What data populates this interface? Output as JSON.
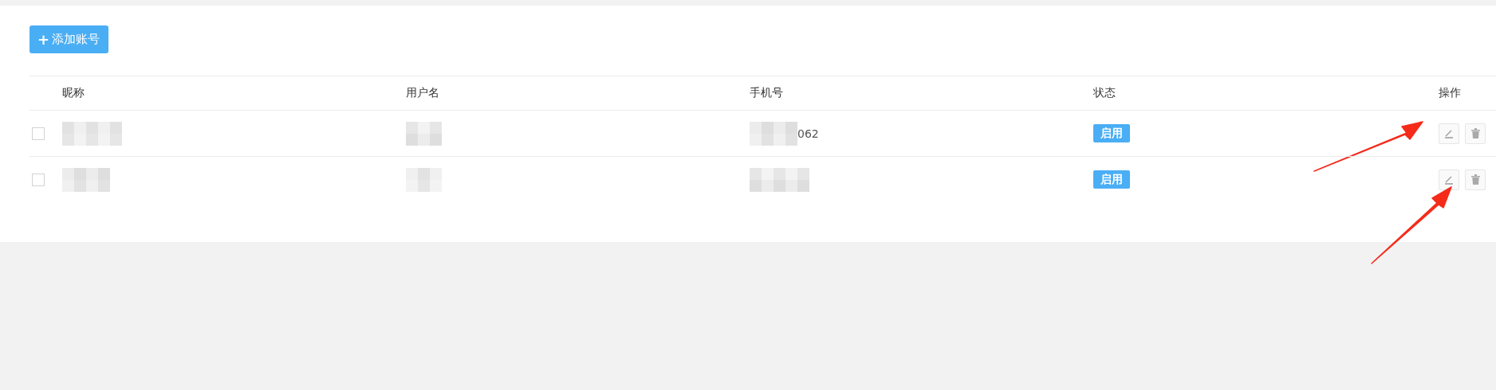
{
  "toolbar": {
    "add_button": {
      "icon": "+",
      "label": "添加账号"
    }
  },
  "table": {
    "columns": [
      "昵称",
      "用户名",
      "手机号",
      "状态",
      "操作"
    ],
    "rows": [
      {
        "checked": false,
        "nickname": {
          "redacted": true
        },
        "username": {
          "redacted": true
        },
        "phone": {
          "redacted": true,
          "visible": "062"
        },
        "status": "启用",
        "marked": true
      },
      {
        "checked": false,
        "nickname": {
          "redacted": true
        },
        "username": {
          "redacted": true
        },
        "phone": {
          "redacted": true
        },
        "status": "启用",
        "marked": true
      }
    ]
  }
}
